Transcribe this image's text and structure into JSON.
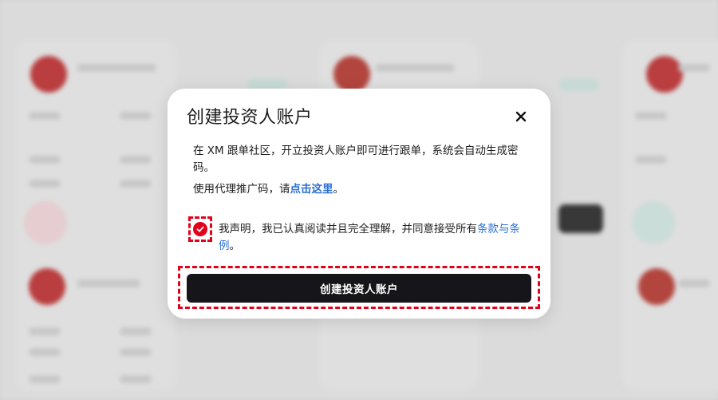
{
  "modal": {
    "title": "创建投资人账户",
    "description": "在 XM 跟单社区，开立投资人账户即可进行跟单，系统会自动生成密码。",
    "agent_prefix": "使用代理推广码，请",
    "agent_link": "点击这里",
    "agent_suffix": "。",
    "consent_prefix": "我声明，我已认真阅读并且完全理解，并同意接受所有",
    "consent_link": "条款与条例",
    "consent_suffix": "。",
    "consent_checked": true,
    "submit_label": "创建投资人账户"
  },
  "icons": {
    "close": "close-icon",
    "check": "check-icon"
  },
  "colors": {
    "accent_red": "#e3001b",
    "link_blue": "#2a6fd6",
    "button_dark": "#16161a",
    "modal_bg": "#ffffff"
  }
}
